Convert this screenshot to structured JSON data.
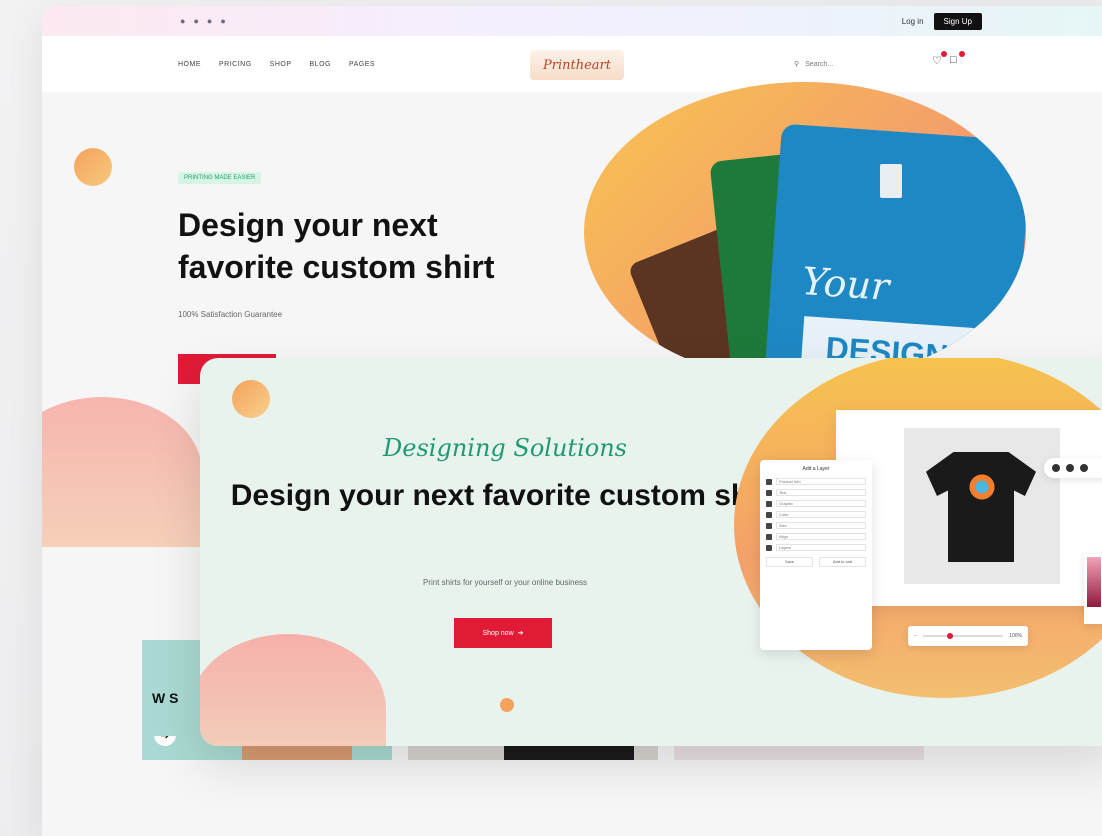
{
  "back": {
    "topbar": {
      "social_icons": [
        "twitter-icon",
        "facebook-icon",
        "instagram-icon",
        "pinterest-icon"
      ],
      "login": "Log in",
      "signup": "Sign Up"
    },
    "nav": {
      "links": [
        "HOME",
        "PRICING",
        "SHOP",
        "BLOG",
        "PAGES"
      ],
      "logo": "Printheart",
      "search_placeholder": "Search..."
    },
    "hero": {
      "badge": "PRINTING MADE EASIER",
      "title": "Design your next favorite custom shirt",
      "subtitle": "100% Satisfaction Guarantee",
      "shirt_text1": "Your",
      "shirt_text2": "DESIGN"
    },
    "cards": {
      "card1_text": "W S"
    }
  },
  "front": {
    "script_title": "Designing Solutions",
    "title": "Design your next favorite custom shirt",
    "subtitle": "Print shirts for yourself or your online business",
    "cta": "Shop now",
    "panel": {
      "title": "Add a Layer",
      "rows": [
        "Product Info",
        "Text",
        "Graphic",
        "Color",
        "Size",
        "Align",
        "Layers"
      ],
      "actions": [
        "Save",
        "Add to cart"
      ]
    },
    "zoom_label": "100%"
  }
}
